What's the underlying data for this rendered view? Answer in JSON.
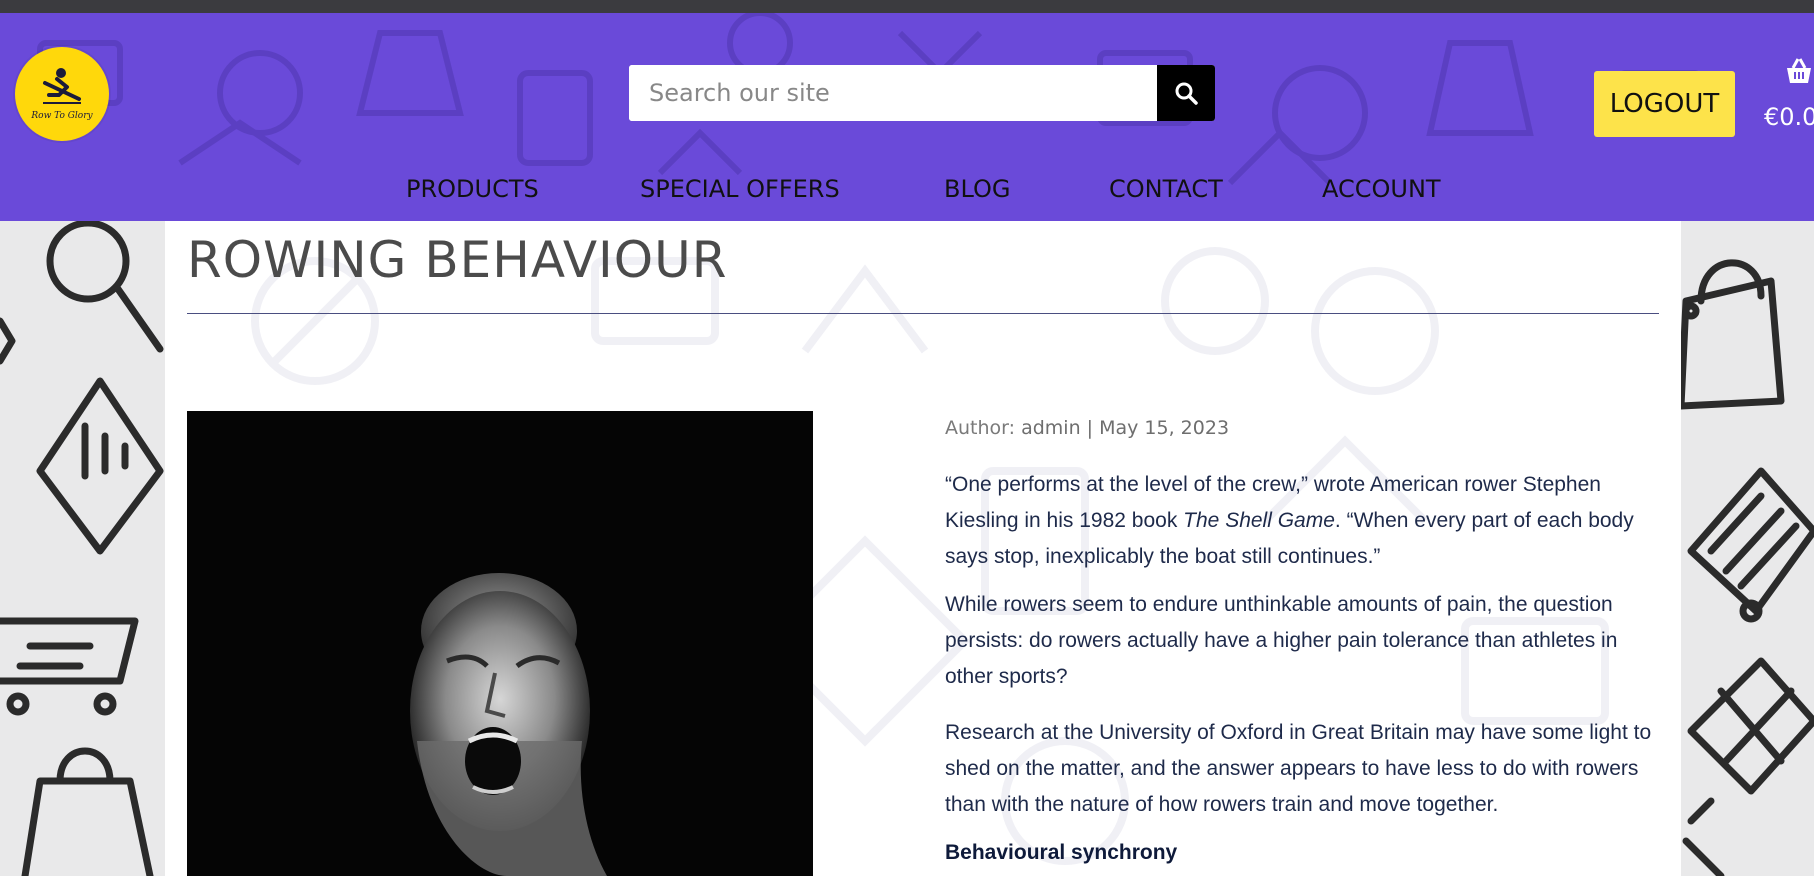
{
  "header": {
    "logo_text": "Row To Glory",
    "search": {
      "placeholder": "Search our site"
    },
    "logout_label": "LOGOUT",
    "cart_total": "€0.0"
  },
  "nav": {
    "items": [
      {
        "label": "PRODUCTS"
      },
      {
        "label": "SPECIAL OFFERS"
      },
      {
        "label": "BLOG"
      },
      {
        "label": "CONTACT"
      },
      {
        "label": "ACCOUNT"
      }
    ]
  },
  "post": {
    "title": "ROWING BEHAVIOUR",
    "author_prefix": "Author: ",
    "author": "admin",
    "separator": " | ",
    "date": "May 15, 2023",
    "p1_a": "“One performs at the level of the crew,” wrote American rower Stephen Kiesling in his 1982 book ",
    "p1_book": "The Shell Game",
    "p1_b": ". “When every part of each body says stop, inexplicably the boat still continues.”",
    "p2": "While rowers seem to endure unthinkable amounts of pain, the question persists: do rowers actually have a higher pain tolerance than athletes in other sports?",
    "p3": "Research at the University of Oxford in Great Britain may have some light to shed on the matter, and the answer appears to have less to do with rowers than with the nature of how rowers train and move together.",
    "heading": "Behavioural synchrony"
  },
  "colors": {
    "header_bg": "#6a4ad9",
    "logout_bg": "#fde34a",
    "logo_bg": "#ffd80b",
    "text": "#1e2a4a"
  },
  "icons": [
    "search-icon",
    "basket-icon",
    "rower-logo-icon"
  ]
}
